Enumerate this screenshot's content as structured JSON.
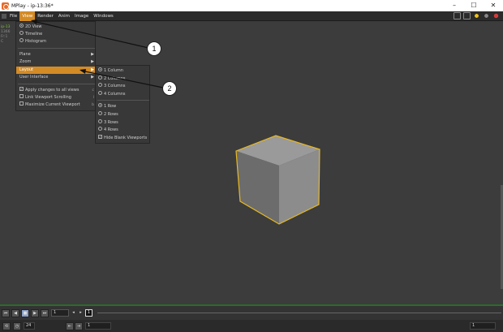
{
  "window": {
    "title": "MPlay - ip-13:36*",
    "controls": [
      "–",
      "☐",
      "✕"
    ]
  },
  "menubar": {
    "items": [
      "File",
      "View",
      "Render",
      "Anim",
      "Image",
      "Windows"
    ],
    "active": "View"
  },
  "side_text": {
    "line1": "ip-13",
    "line2": "1366",
    "line3": "Fr:1",
    "line4": "C"
  },
  "view_menu": {
    "items": [
      {
        "type": "radio",
        "label": "2D View",
        "checked": true
      },
      {
        "type": "radio",
        "label": "Timeline",
        "checked": false
      },
      {
        "type": "radio",
        "label": "Histogram",
        "checked": false
      },
      {
        "type": "submenu",
        "label": "Plane"
      },
      {
        "type": "submenu",
        "label": "Zoom"
      },
      {
        "type": "submenu",
        "label": "Layout",
        "highlighted": true
      },
      {
        "type": "submenu",
        "label": "User Interface"
      },
      {
        "type": "check",
        "label": "Apply changes to all views",
        "checked": true,
        "shortcut": "c"
      },
      {
        "type": "check",
        "label": "Link Viewport Scrolling",
        "checked": false,
        "shortcut": "l"
      },
      {
        "type": "check",
        "label": "Maximize Current Viewport",
        "checked": false,
        "shortcut": "b"
      }
    ]
  },
  "layout_submenu": {
    "columns": [
      {
        "label": "1 Column",
        "checked": true
      },
      {
        "label": "2 Columns",
        "checked": false
      },
      {
        "label": "3 Columns",
        "checked": false
      },
      {
        "label": "4 Columns",
        "checked": false
      }
    ],
    "rows": [
      {
        "label": "1 Row",
        "checked": true
      },
      {
        "label": "2 Rows",
        "checked": false
      },
      {
        "label": "3 Rows",
        "checked": false
      },
      {
        "label": "4 Rows",
        "checked": false
      }
    ],
    "hide_blank": {
      "label": "Hide Blank Viewports",
      "checked": true
    }
  },
  "callouts": {
    "one": "1",
    "two": "2"
  },
  "playbar": {
    "current_frame": "1",
    "frame_box": "1"
  },
  "statusbar": {
    "fps": "24",
    "start_frame": "1",
    "end_frame": "1"
  },
  "colors": {
    "accent": "#d38b26",
    "cube_outline": "#e8b923",
    "viewport_bg": "#3c3c3c"
  }
}
